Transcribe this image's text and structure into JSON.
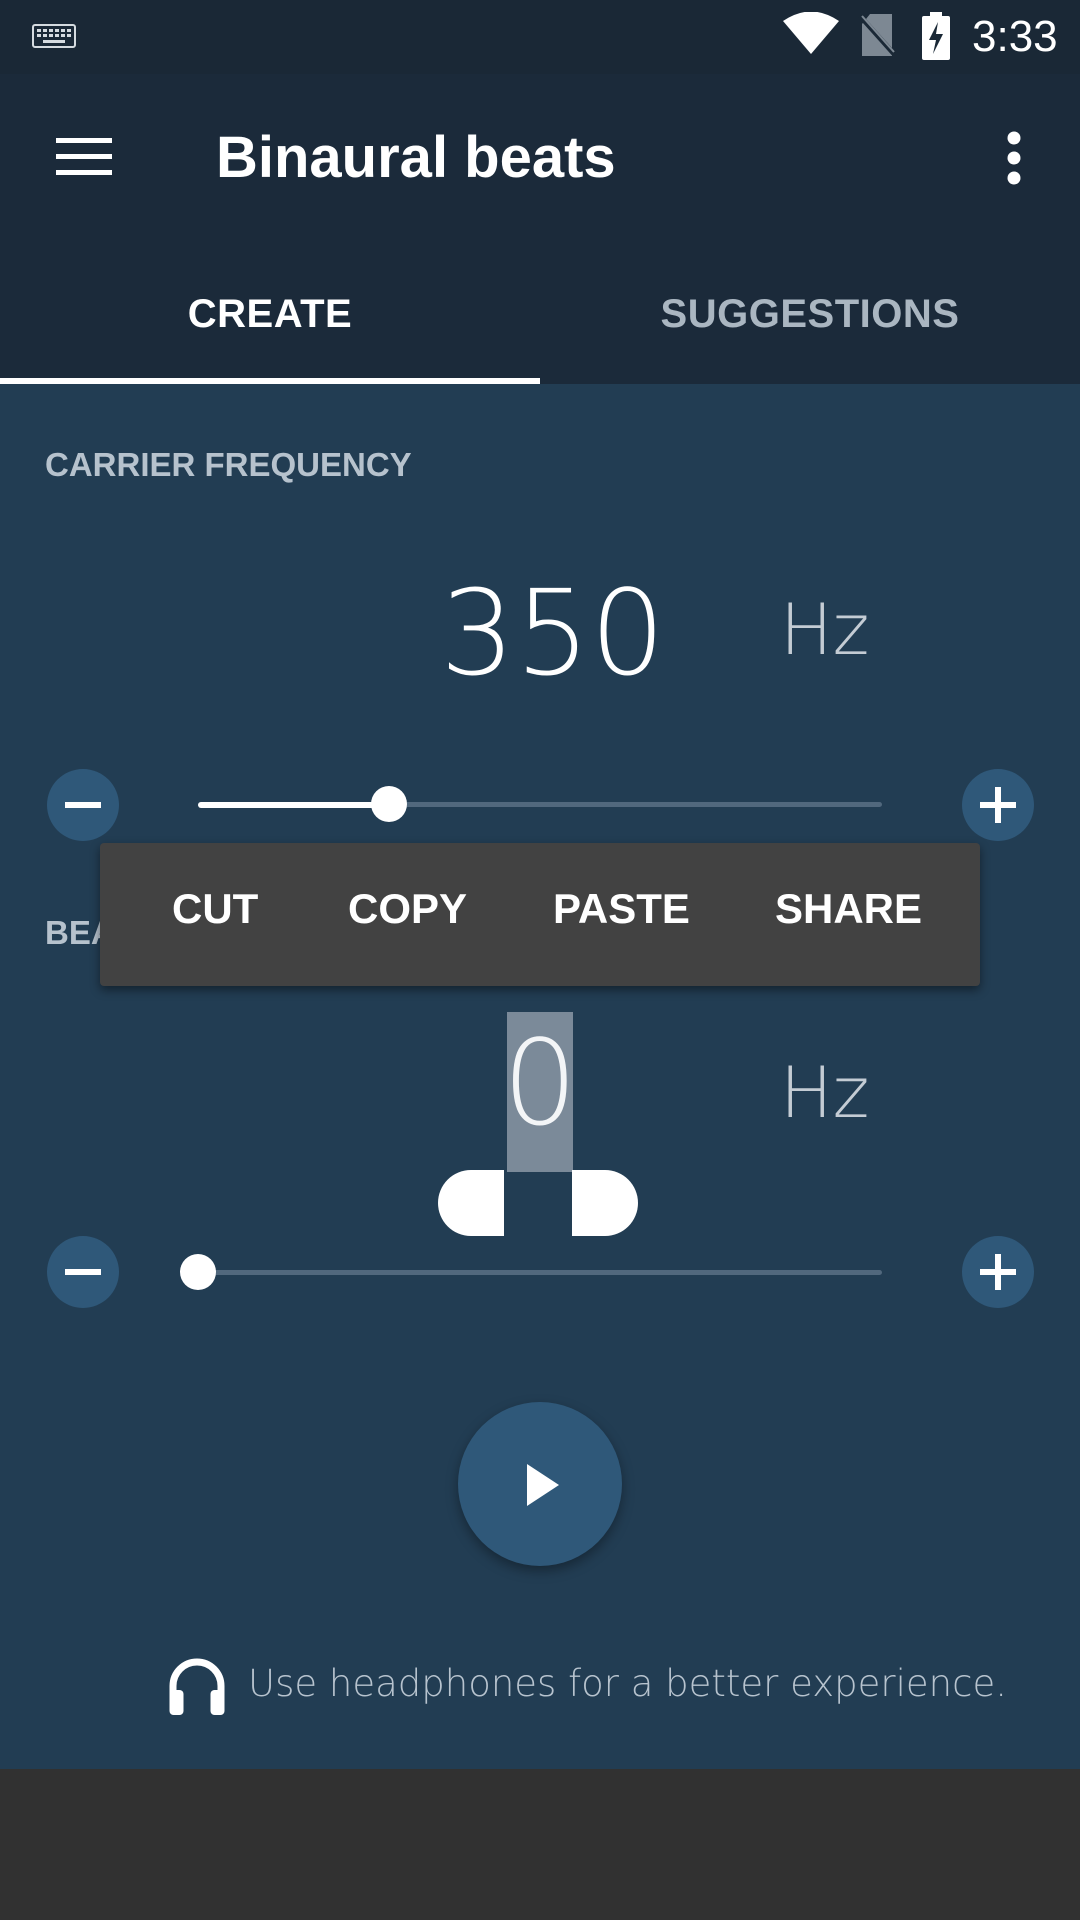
{
  "status_bar": {
    "time": "3:33",
    "icons": [
      "keyboard-icon",
      "wifi-icon",
      "no-sim-icon",
      "battery-charging-icon"
    ]
  },
  "app_bar": {
    "title": "Binaural beats",
    "menu_icon": "hamburger-menu-icon",
    "overflow_icon": "more-vert-icon"
  },
  "tabs": [
    {
      "label": "CREATE",
      "selected": true
    },
    {
      "label": "SUGGESTIONS",
      "selected": false
    }
  ],
  "carrier": {
    "label": "CARRIER FREQUENCY",
    "value": "350",
    "unit": "Hz",
    "slider_fraction": 0.28
  },
  "beat": {
    "label_visible": "BEA",
    "value": "0",
    "unit": "Hz",
    "slider_fraction": 0.0
  },
  "context_menu": {
    "items": [
      "CUT",
      "COPY",
      "PASTE",
      "SHARE"
    ]
  },
  "play_button": {
    "icon": "play-icon"
  },
  "hint": {
    "icon": "headphones-icon",
    "text": "Use headphones for a better experience."
  },
  "colors": {
    "status_bar": "#1a2836",
    "app_bar": "#1b2a3a",
    "content": "#223d53",
    "accent_button": "#2f5879",
    "menu": "#424242",
    "nav_bar": "#313131"
  }
}
